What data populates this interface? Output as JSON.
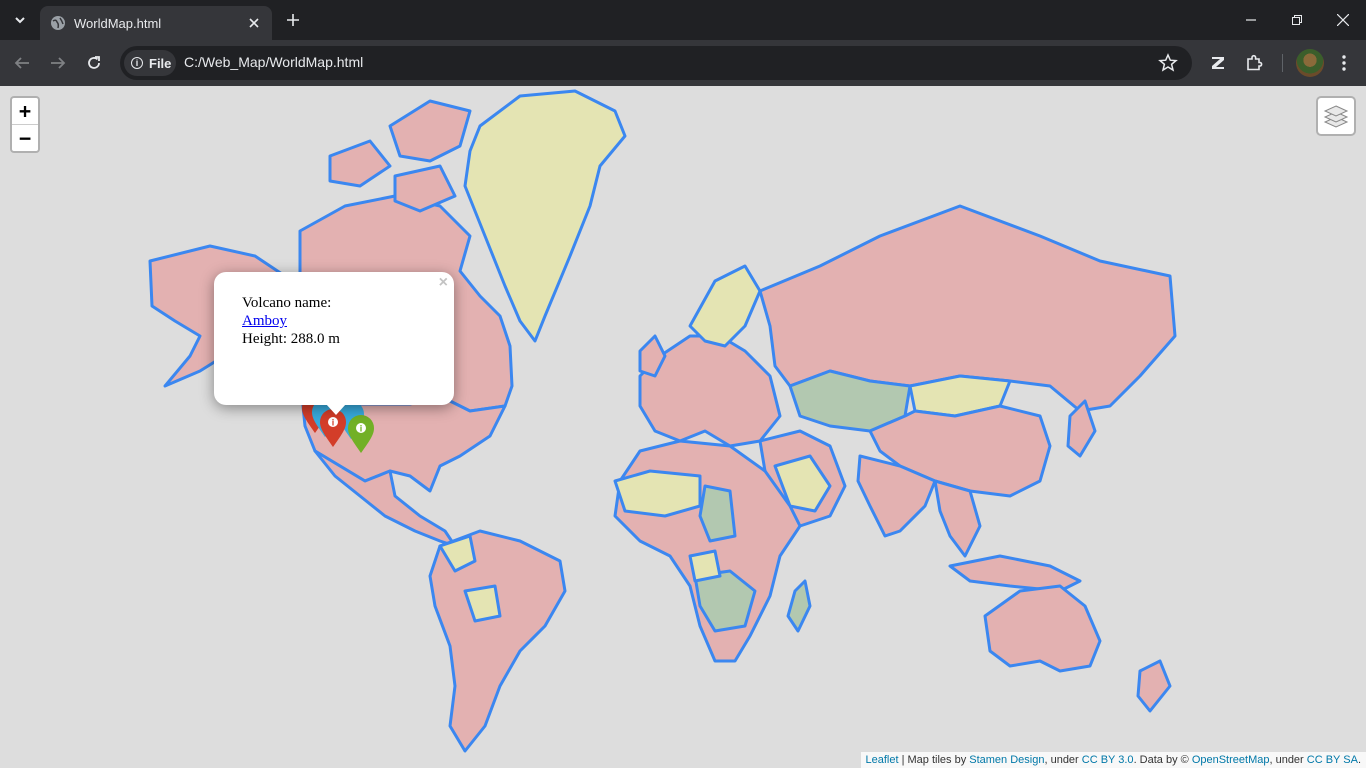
{
  "browser": {
    "tab_title": "WorldMap.html",
    "chip_label": "File",
    "url": "C:/Web_Map/WorldMap.html"
  },
  "map": {
    "zoom_in": "+",
    "zoom_out": "−",
    "popup": {
      "label": "Volcano name:",
      "name": "Amboy",
      "height": "Height: 288.0 m",
      "close": "×"
    },
    "attribution": {
      "leaflet": "Leaflet",
      "sep1": " | Map tiles by ",
      "stamen": "Stamen Design",
      "sep2": ", under ",
      "ccby30": "CC BY 3.0",
      "sep3": ". Data by © ",
      "osm": "OpenStreetMap",
      "sep4": ", under ",
      "ccbysa": "CC BY SA",
      "end": "."
    },
    "colors": {
      "background": "#dddddd",
      "border": "#3b87f0",
      "fill_pink": "#e3b1b1",
      "fill_yellow": "#e4e4b3",
      "fill_green": "#b2c8b0",
      "marker_red": "#d33d29",
      "marker_green": "#72b026",
      "marker_blue": "#38aadd"
    }
  }
}
